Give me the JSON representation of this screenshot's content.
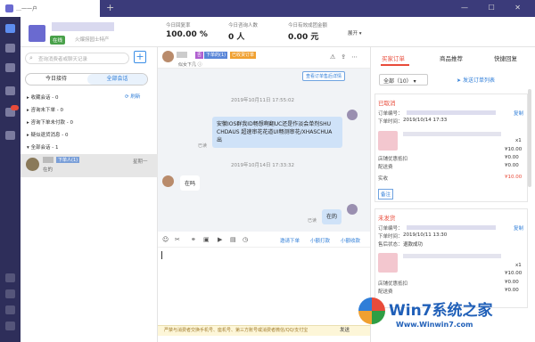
{
  "titlebar": {
    "tab_title": "…一一户",
    "new_tab": "+",
    "window_controls": "— ☐ ✕"
  },
  "header": {
    "status": "在线",
    "store_desc": "火爆捞园士特产",
    "stats": [
      {
        "label": "今日回复率",
        "value": "100.00 %"
      },
      {
        "label": "今日咨询人数",
        "value": "0 人"
      },
      {
        "label": "今日有效成团金额",
        "value": "0.00 元"
      }
    ],
    "expand": "展开"
  },
  "left": {
    "search_placeholder": "查询消费者或聊天记录",
    "seg": [
      "今日接待",
      "全部会话"
    ],
    "groups": [
      {
        "label": "收藏会话 - 0"
      },
      {
        "label": "咨询未下单 - 0"
      },
      {
        "label": "咨询下单未付款 - 0"
      },
      {
        "label": "疑似退货消息 - 0"
      },
      {
        "label": "全部会话 - 1"
      }
    ],
    "refresh": "刷新",
    "conversation": {
      "tag": "下单人(1)",
      "time": "星期一",
      "msg": "在的"
    }
  },
  "chat": {
    "tags": [
      "否",
      "下单的(1)",
      "已收货订单"
    ],
    "subtitle": "似女下几 ⓘ",
    "history_btn": "查看订单售后详情",
    "messages": [
      {
        "time": "2019年10月11日 17:55:02",
        "text": "安徽IOS群我ID畅想啊翻UC还是作淡会单剂SHU CHDAUS 超速审花花道UI畅测审花/XHASCHUA 出",
        "read": "已读"
      },
      {
        "time": "2019年10月14日 17:33:32",
        "text": "在吗"
      },
      {
        "text": "在的",
        "read": "已读"
      }
    ],
    "tool_links": [
      "邀请下单",
      "小额打款",
      "小额收款"
    ],
    "warning": "严禁与消费者交换手机号、座机号、第三方账号或消费者微信/QQ/支付宝",
    "send": "发送"
  },
  "right": {
    "tabs": [
      "买家订单",
      "商品推荐",
      "快捷回复"
    ],
    "filter": "全部（10）",
    "send_order_link": "发送订单列表",
    "orders": [
      {
        "status": "已取消",
        "order_no_label": "订单编号：",
        "copy": "复制",
        "time_label": "下单时间：",
        "time": "2019/10/14 17:33",
        "qty": "x1",
        "price": "¥10.00",
        "discount_label": "店铺优惠抵扣",
        "discount": "¥0.00",
        "ship_label": "配送费",
        "ship": "¥0.00",
        "paid_label": "实收",
        "paid": "¥10.00",
        "note": "备注"
      },
      {
        "status": "未发货",
        "order_no_label": "订单编号：",
        "copy": "复制",
        "time_label": "下单时间：",
        "time": "2019/10/11 13:30",
        "after_label": "售后状态：",
        "after": "退款成功",
        "qty": "x1",
        "price": "¥10.00",
        "discount_label": "店铺优惠抵扣",
        "discount": "¥0.00",
        "ship_label": "配送费",
        "ship": "¥0.00"
      }
    ]
  },
  "watermark": {
    "text": "Win7系统之家",
    "url": "Www.Winwin7.com"
  }
}
